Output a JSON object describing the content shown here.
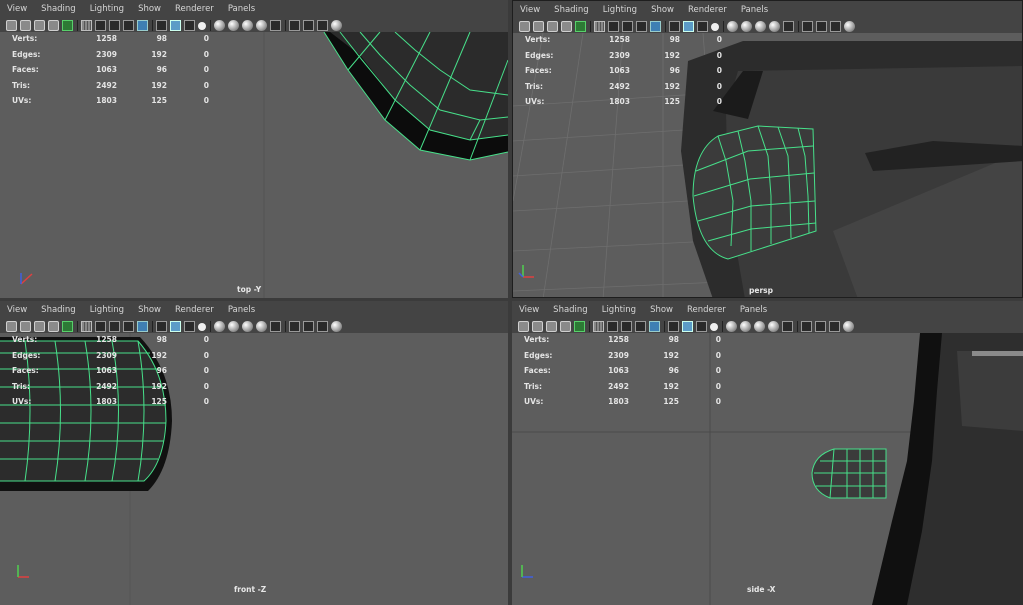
{
  "menus": [
    "View",
    "Shading",
    "Lighting",
    "Show",
    "Renderer",
    "Panels"
  ],
  "hud": {
    "labels": [
      "Verts:",
      "Edges:",
      "Faces:",
      "Tris:",
      "UVs:"
    ],
    "col1": [
      "1258",
      "2309",
      "1063",
      "2492",
      "1803"
    ],
    "col2": [
      "98",
      "192",
      "96",
      "192",
      "125"
    ],
    "col3": [
      "0",
      "0",
      "0",
      "0",
      "0"
    ]
  },
  "panes": {
    "top_left": {
      "camera": "top -Y"
    },
    "top_right": {
      "camera": "persp"
    },
    "bottom_left": {
      "camera": "front -Z"
    },
    "bottom_right": {
      "camera": "side -X"
    }
  },
  "icons": [
    "camera-icon",
    "grid-icon",
    "select-icon",
    "wireframe-icon",
    "smooth-shade-icon",
    "textured-icon",
    "light-icon",
    "isolate-icon",
    "xray-icon",
    "settings-icon"
  ],
  "colors": {
    "wire": "#47e08a",
    "viewport": "#5d5d5d",
    "menubar": "#444444"
  }
}
